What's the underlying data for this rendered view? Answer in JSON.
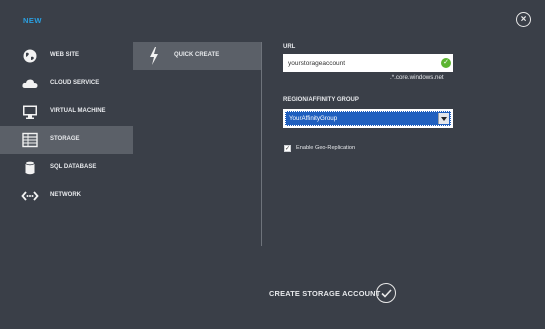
{
  "dialog": {
    "title": "NEW",
    "close_icon": "close-icon"
  },
  "nav": {
    "items": [
      {
        "label": "WEB SITE",
        "icon": "globe-icon"
      },
      {
        "label": "CLOUD SERVICE",
        "icon": "cloud-icon"
      },
      {
        "label": "VIRTUAL MACHINE",
        "icon": "monitor-icon"
      },
      {
        "label": "STORAGE",
        "icon": "table-grid-icon",
        "active": true
      },
      {
        "label": "SQL DATABASE",
        "icon": "database-icon"
      },
      {
        "label": "NETWORK",
        "icon": "network-icon"
      }
    ]
  },
  "subnav": {
    "items": [
      {
        "label": "QUICK CREATE",
        "icon": "lightning-icon",
        "active": true
      }
    ]
  },
  "form": {
    "url_label": "URL",
    "url_value": "yourstorageaccount",
    "url_suffix": ".*.core.windows.net",
    "region_label": "REGION/AFFINITY GROUP",
    "region_value": "YourAffinityGroup",
    "geo_label": "Enable Geo-Replication",
    "geo_checked": true
  },
  "footer": {
    "create_label": "CREATE STORAGE ACCOUNT"
  },
  "colors": {
    "background": "#3a3f48",
    "active_item": "#5b6068",
    "title_accent": "#2a9fe0",
    "select_highlight": "#1f5fbf",
    "valid_check": "#5cb531"
  }
}
